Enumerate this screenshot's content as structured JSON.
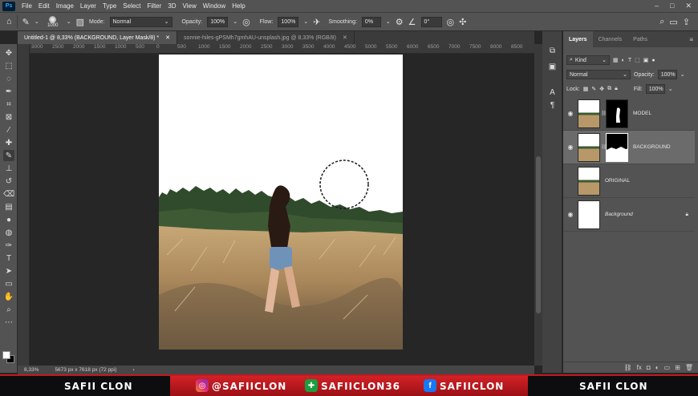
{
  "menu": [
    "File",
    "Edit",
    "Image",
    "Layer",
    "Type",
    "Select",
    "Filter",
    "3D",
    "View",
    "Window",
    "Help"
  ],
  "app_logo": "Ps",
  "options": {
    "brush_size": "1000",
    "mode_label": "Mode:",
    "mode_value": "Normal",
    "opacity_label": "Opacity:",
    "opacity_value": "100%",
    "flow_label": "Flow:",
    "flow_value": "100%",
    "smoothing_label": "Smoothing:",
    "smoothing_value": "0%",
    "angle_value": "0°"
  },
  "tabs": [
    {
      "label": "Untitled-1 @ 8,33% (BACKGROUND, Layer Mask/8) *",
      "active": true
    },
    {
      "label": "sonnie-hiles-gPSMh7gmhAU-unsplash.jpg @ 8,33% (RGB/8)",
      "active": false
    }
  ],
  "ruler_ticks": [
    "3000",
    "2500",
    "2000",
    "1500",
    "1000",
    "500",
    "0",
    "500",
    "1000",
    "1500",
    "2000",
    "2500",
    "3000",
    "3500",
    "4000",
    "4500",
    "5000",
    "5500",
    "6000",
    "6500",
    "7000",
    "7500",
    "8000",
    "8500"
  ],
  "status": {
    "zoom": "8,33%",
    "doc_size": "5673 px x 7618 px (72 ppi)"
  },
  "panel": {
    "tabs": [
      "Layers",
      "Channels",
      "Paths"
    ],
    "kind_label": "Kind",
    "blend_mode": "Normal",
    "opacity_label": "Opacity:",
    "opacity_value": "100%",
    "lock_label": "Lock:",
    "fill_label": "Fill:",
    "fill_value": "100%",
    "layers": [
      {
        "name": "MODEL",
        "visible": true,
        "has_mask": true,
        "selected": false
      },
      {
        "name": "BACKGROUND",
        "visible": true,
        "has_mask": true,
        "selected": true
      },
      {
        "name": "ORIGINAL",
        "visible": false,
        "has_mask": false,
        "selected": false
      },
      {
        "name": "Background",
        "visible": true,
        "has_mask": false,
        "selected": false,
        "locked": true
      }
    ]
  },
  "banner": {
    "left_name": "SAFII CLON",
    "instagram": "@SAFIICLON",
    "other": "SAFIICLON36",
    "facebook": "SAFIICLON",
    "right_name": "SAFII CLON"
  },
  "colors": {
    "ui_dark": "#535353",
    "canvas_bg": "#262626",
    "accent_red": "#c11a1f"
  }
}
